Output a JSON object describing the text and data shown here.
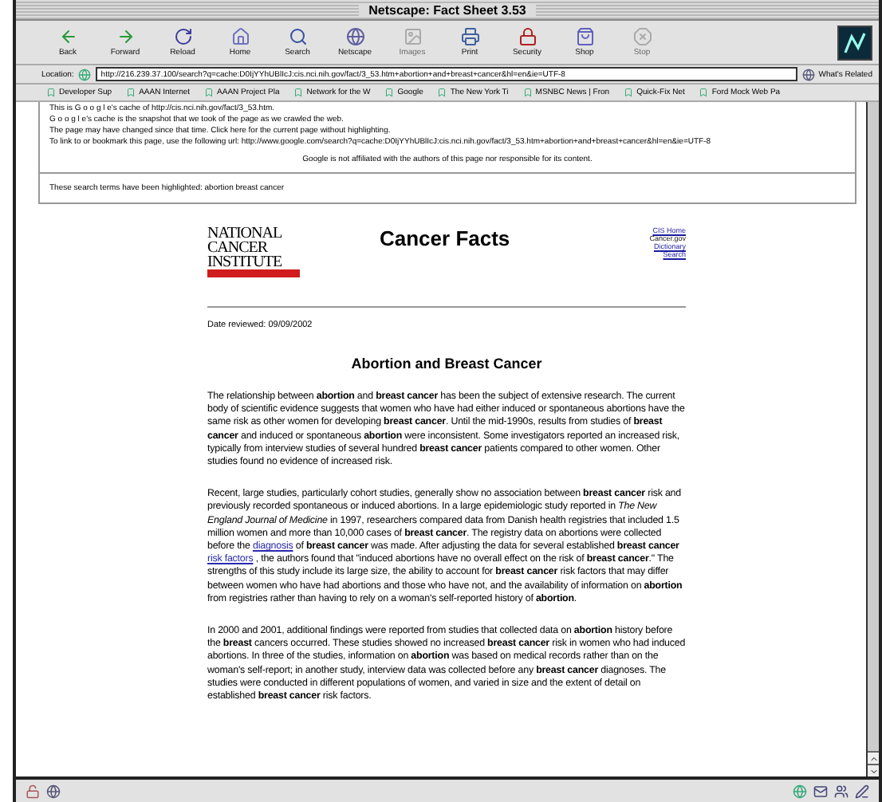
{
  "window": {
    "title": "Netscape: Fact Sheet 3.53"
  },
  "toolbar": [
    {
      "label": "Back",
      "disabled": false
    },
    {
      "label": "Forward",
      "disabled": false
    },
    {
      "label": "Reload",
      "disabled": false
    },
    {
      "label": "Home",
      "disabled": false
    },
    {
      "label": "Search",
      "disabled": false
    },
    {
      "label": "Netscape",
      "disabled": false
    },
    {
      "label": "Images",
      "disabled": true
    },
    {
      "label": "Print",
      "disabled": false
    },
    {
      "label": "Security",
      "disabled": false
    },
    {
      "label": "Shop",
      "disabled": false
    },
    {
      "label": "Stop",
      "disabled": true
    }
  ],
  "location": {
    "label": "Location:",
    "value": "http://216.239.37.100/search?q=cache:D0IjYYhUBlIcJ:cis.nci.nih.gov/fact/3_53.htm+abortion+and+breast+cancer&hl=en&ie=UTF-8",
    "related": "What's Related"
  },
  "bookmarks": [
    "Developer Sup",
    "AAAN Internet",
    "AAAN Project Pla",
    "Network for the W",
    "Google",
    "The New York Ti",
    "MSNBC News | Fron",
    "Quick-Fix Net",
    "Ford Mock Web Pa"
  ],
  "cache_notice": {
    "lines": [
      "This is G o o g l e's cache of http://cis.nci.nih.gov/fact/3_53.htm.",
      "G o o g l e's cache is the snapshot that we took of the page as we crawled the web.",
      "The page may have changed since that time. Click here for the current page without highlighting.",
      "To link to or bookmark this page, use the following url: http://www.google.com/search?q=cache:D0IjYYhUBlIcJ:cis.nci.nih.gov/fact/3_53.htm+abortion+and+breast+cancer&hl=en&ie=UTF-8",
      "Google is not affiliated with the authors of this page nor responsible for its content."
    ],
    "highlighted": "These search terms have been highlighted: abortion breast cancer"
  },
  "page": {
    "logo": [
      "NATIONAL",
      "CANCER",
      "INSTITUTE"
    ],
    "title": "Cancer Facts",
    "links": [
      "CIS Home",
      "Cancer.gov",
      "Dictionary",
      "Search"
    ],
    "date": "Date reviewed: 09/09/2002",
    "heading": "Abortion and Breast Cancer",
    "paragraphs": [
      [
        {
          "kind": "text",
          "text": "The relationship between **abortion** and **breast cancer** has been the subject of extensive research. The current body of scientific evidence suggests that women who have had either induced or spontaneous abortions have the same risk as other women for developing **breast cancer**. Until the mid-1990s, results from studies of **breast cancer** and induced or spontaneous **abortion** were inconsistent. Some investigators reported an increased risk, typically from interview studies of several hundred **breast cancer** patients compared to other women. Other studies found no evidence of increased risk."
        }
      ],
      [
        {
          "kind": "text",
          "text": "Recent, large studies, particularly cohort studies, generally show no association between **breast cancer** risk and previously recorded spontaneous or induced abortions. In a large epidemiologic study reported in *The New England Journal of Medicine* in 1997, researchers compared data from Danish health registries that included 1.5 million women and more than 10,000 cases of **breast cancer**. The registry data on abortions were collected before the"
        },
        {
          "kind": "link",
          "text": "diagnosis"
        },
        {
          "kind": "text",
          "text": "of **breast cancer** was made. After adjusting the data for several established **breast cancer**"
        },
        {
          "kind": "link",
          "text": "risk factors"
        },
        {
          "kind": "text",
          "text": ", the authors found that \"induced abortions have no overall effect on the risk of **breast cancer**.\" The strengths of this study include its large size, the ability to account for **breast cancer** risk factors that may differ between women who have had abortions and those who have not, and the availability of information on **abortion** from registries rather than having to rely on a woman's self-reported history of **abortion**."
        }
      ],
      [
        {
          "kind": "text",
          "text": "In 2000 and 2001, additional findings were reported from studies that collected data on **abortion** history before the **breast** cancers occurred. These studies showed no increased **breast cancer** risk in women who had induced abortions. In three of the studies, information on **abortion** was based on medical records rather than on the woman's self-report; in another study, interview data was collected before any **breast cancer** diagnoses. The studies were conducted in different populations of women, and varied in size and the extent of detail on established **breast cancer** risk factors."
        }
      ]
    ]
  }
}
